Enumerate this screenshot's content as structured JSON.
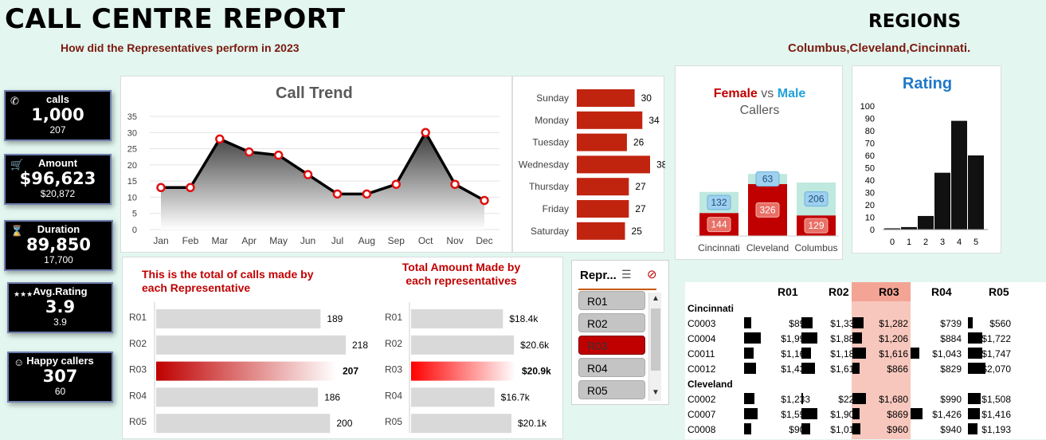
{
  "header": {
    "title": "CALL CENTRE REPORT",
    "subtitle": "How did the Representatives perform in 2023",
    "regions_title": "REGIONS",
    "regions_list": "Columbus,Cleveland,Cincinnati."
  },
  "kpis": [
    {
      "label": "calls",
      "value": "1,000",
      "sub": "207",
      "icon": "phone-icon"
    },
    {
      "label": "Amount",
      "value": "$96,623",
      "sub": "$20,872",
      "icon": "cart-icon"
    },
    {
      "label": "Duration",
      "value": "89,850",
      "sub": "17,700",
      "icon": "hourglass-icon"
    },
    {
      "label": "Avg.Rating",
      "value": "3.9",
      "sub": "3.9",
      "icon": "stars-icon"
    },
    {
      "label": "Happy callers",
      "value": "307",
      "sub": "60",
      "icon": "smiley-icon"
    }
  ],
  "colors": {
    "accent_red": "#c00000",
    "female": "#c00000",
    "male": "#bfe8df",
    "male_text": "#1fa2d8",
    "bar_grey": "#d9d9d9",
    "dark": "#111111"
  },
  "chart_data": [
    {
      "type": "area",
      "title": "Call Trend",
      "categories": [
        "Jan",
        "Feb",
        "Mar",
        "Apr",
        "May",
        "Jun",
        "Jul",
        "Aug",
        "Sep",
        "Oct",
        "Nov",
        "Dec"
      ],
      "values": [
        13,
        13,
        28,
        24,
        23,
        17,
        11,
        11,
        14,
        30,
        14,
        9
      ],
      "ylim": [
        0,
        35
      ],
      "yticks": [
        0,
        5,
        10,
        15,
        20,
        25,
        30,
        35
      ]
    },
    {
      "type": "bar",
      "orientation": "horizontal",
      "categories": [
        "Sunday",
        "Monday",
        "Tuesday",
        "Wednesday",
        "Thursday",
        "Friday",
        "Saturday"
      ],
      "values": [
        30,
        34,
        26,
        38,
        27,
        27,
        25
      ]
    },
    {
      "type": "bar",
      "stacked": true,
      "title": "Female vs Male Callers",
      "title_parts": {
        "female": "Female",
        "vs": "vs",
        "male": "Male",
        "rest": "Callers"
      },
      "categories": [
        "Cincinnati",
        "Cleveland",
        "Columbus"
      ],
      "series": [
        {
          "name": "Female",
          "values": [
            144,
            326,
            129
          ]
        },
        {
          "name": "Male",
          "values": [
            132,
            63,
            206
          ]
        }
      ]
    },
    {
      "type": "bar",
      "title": "Rating",
      "categories": [
        "0",
        "1",
        "2",
        "3",
        "4",
        "5"
      ],
      "values": [
        1,
        2,
        11,
        46,
        88,
        60
      ],
      "ylim": [
        0,
        100
      ],
      "yticks": [
        0,
        10,
        20,
        30,
        40,
        50,
        60,
        70,
        80,
        90,
        100
      ]
    },
    {
      "type": "bar",
      "orientation": "horizontal",
      "title": "This is the total of calls made by each Representative",
      "categories": [
        "R01",
        "R02",
        "R03",
        "R04",
        "R05"
      ],
      "values": [
        189,
        218,
        207,
        186,
        200
      ],
      "labels": [
        "189",
        "218",
        "207",
        "186",
        "200"
      ],
      "highlight": "R03"
    },
    {
      "type": "bar",
      "orientation": "horizontal",
      "title": "Total Amount Made by each representatives",
      "categories": [
        "R01",
        "R02",
        "R03",
        "R04",
        "R05"
      ],
      "values": [
        18.4,
        20.6,
        20.9,
        16.7,
        20.1
      ],
      "labels": [
        "$18.4k",
        "$20.6k",
        "$20.9k",
        "$16.7k",
        "$20.1k"
      ],
      "highlight": "R03"
    }
  ],
  "slicer": {
    "title": "Repr...",
    "items": [
      "R01",
      "R02",
      "R03",
      "R04",
      "R05"
    ],
    "selected": "R03"
  },
  "table": {
    "columns": [
      "R01",
      "R02",
      "R03",
      "R04",
      "R05"
    ],
    "highlight": "R03",
    "groups": [
      {
        "name": "Cincinnati",
        "rows": [
          {
            "id": "C0003",
            "cells": [
              "$891",
              "$1,332",
              "$1,282",
              "$739",
              "$560"
            ],
            "bars": [
              0.3,
              0.45,
              0.45,
              0,
              0.2
            ]
          },
          {
            "id": "C0004",
            "cells": [
              "$1,991",
              "$1,886",
              "$1,206",
              "$884",
              "$1,722"
            ],
            "bars": [
              0.7,
              0.65,
              0.4,
              0,
              0.6
            ]
          },
          {
            "id": "C0011",
            "cells": [
              "$1,163",
              "$1,180",
              "$1,616",
              "$1,043",
              "$1,747"
            ],
            "bars": [
              0.4,
              0.4,
              0.55,
              0.35,
              0.6
            ]
          },
          {
            "id": "C0012",
            "cells": [
              "$1,438",
              "$1,616",
              "$866",
              "$829",
              "$2,070"
            ],
            "bars": [
              0.5,
              0.55,
              0.3,
              0,
              0.72
            ]
          }
        ]
      },
      {
        "name": "Cleveland",
        "rows": [
          {
            "id": "C0002",
            "cells": [
              "$1,233",
              "$223",
              "$1,680",
              "$990",
              "$1,508"
            ],
            "bars": [
              0.43,
              0.08,
              0.58,
              0,
              0.52
            ]
          },
          {
            "id": "C0007",
            "cells": [
              "$1,598",
              "$1,907",
              "$869",
              "$1,426",
              "$1,416"
            ],
            "bars": [
              0.55,
              0.67,
              0.3,
              0.5,
              0.49
            ]
          },
          {
            "id": "C0008",
            "cells": [
              "$900",
              "$1,016",
              "$960",
              "$940",
              "$1,193"
            ],
            "bars": [
              0.31,
              0.35,
              0.33,
              0,
              0.41
            ]
          }
        ]
      }
    ]
  }
}
